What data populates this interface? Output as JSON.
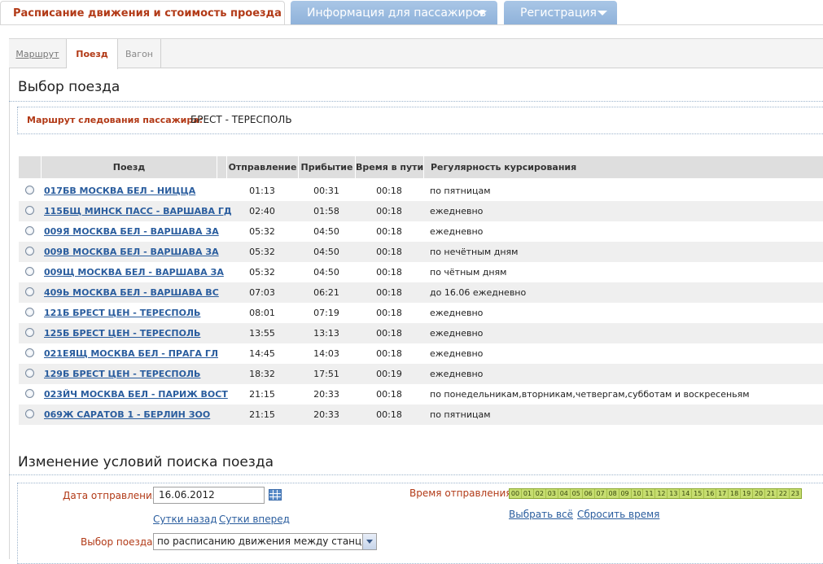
{
  "top_tabs": {
    "active": "Расписание движения и стоимость проезда",
    "info": "Информация для пассажиров",
    "registration": "Регистрация"
  },
  "sub_tabs": {
    "route": "Маршрут",
    "train": "Поезд",
    "car": "Вагон"
  },
  "section_title": "Выбор поезда",
  "route": {
    "label": "Маршрут следования пассажира:",
    "value": "БРЕСТ - ТЕРЕСПОЛЬ"
  },
  "table": {
    "headers": {
      "train": "Поезд",
      "departure": "Отправление",
      "arrival": "Прибытие",
      "travel_time": "Время в пути",
      "regularity": "Регулярность курсирования"
    },
    "rows": [
      {
        "train": "017БВ МОСКВА БЕЛ - НИЦЦА",
        "dep": "01:13",
        "arr": "00:31",
        "time": "00:18",
        "reg": "по пятницам"
      },
      {
        "train": "115БЩ МИНСК ПАСС - ВАРШАВА ГД",
        "dep": "02:40",
        "arr": "01:58",
        "time": "00:18",
        "reg": "ежедневно"
      },
      {
        "train": "009Я МОСКВА БЕЛ - ВАРШАВА ЗА",
        "dep": "05:32",
        "arr": "04:50",
        "time": "00:18",
        "reg": "ежедневно"
      },
      {
        "train": "009В МОСКВА БЕЛ - ВАРШАВА ЗА",
        "dep": "05:32",
        "arr": "04:50",
        "time": "00:18",
        "reg": "по нечётным дням"
      },
      {
        "train": "009Щ МОСКВА БЕЛ - ВАРШАВА ЗА",
        "dep": "05:32",
        "arr": "04:50",
        "time": "00:18",
        "reg": "по чётным дням"
      },
      {
        "train": "409Ь МОСКВА БЕЛ - ВАРШАВА ВС",
        "dep": "07:03",
        "arr": "06:21",
        "time": "00:18",
        "reg": "до 16.06 ежедневно"
      },
      {
        "train": "121Б БРЕСТ ЦЕН - ТЕРЕСПОЛЬ",
        "dep": "08:01",
        "arr": "07:19",
        "time": "00:18",
        "reg": "ежедневно"
      },
      {
        "train": "125Б БРЕСТ ЦЕН - ТЕРЕСПОЛЬ",
        "dep": "13:55",
        "arr": "13:13",
        "time": "00:18",
        "reg": "ежедневно"
      },
      {
        "train": "021ЕЯЩ МОСКВА БЕЛ - ПРАГА ГЛ",
        "dep": "14:45",
        "arr": "14:03",
        "time": "00:18",
        "reg": "ежедневно"
      },
      {
        "train": "129Б БРЕСТ ЦЕН - ТЕРЕСПОЛЬ",
        "dep": "18:32",
        "arr": "17:51",
        "time": "00:19",
        "reg": "ежедневно"
      },
      {
        "train": "023ЙЧ МОСКВА БЕЛ - ПАРИЖ ВОСТ",
        "dep": "21:15",
        "arr": "20:33",
        "time": "00:18",
        "reg": "по понедельникам,вторникам,четвергам,субботам и воскресеньям"
      },
      {
        "train": "069Ж САРАТОВ 1 - БЕРЛИН ЗОО",
        "dep": "21:15",
        "arr": "20:33",
        "time": "00:18",
        "reg": "по пятницам"
      }
    ]
  },
  "search": {
    "title": "Изменение условий поиска поезда",
    "date_label": "Дата отправления",
    "date_value": "16.06.2012",
    "day_back": "Сутки назад",
    "day_forward": "Сутки вперед",
    "train_choice_label": "Выбор поезда",
    "train_choice_value": "по расписанию движения между станциями",
    "time_label": "Время отправления",
    "hours": [
      "00",
      "01",
      "02",
      "03",
      "04",
      "05",
      "06",
      "07",
      "08",
      "09",
      "10",
      "11",
      "12",
      "13",
      "14",
      "15",
      "16",
      "17",
      "18",
      "19",
      "20",
      "21",
      "22",
      "23"
    ],
    "select_all": "Выбрать всё",
    "reset_time": "Сбросить время"
  }
}
